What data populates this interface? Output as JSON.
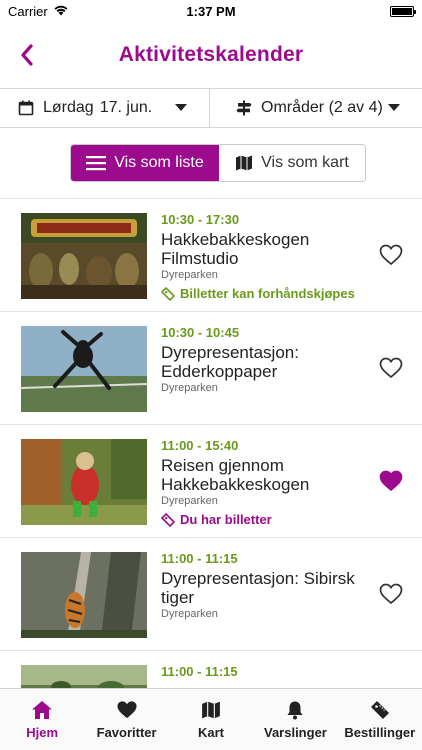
{
  "status_bar": {
    "carrier": "Carrier",
    "time": "1:37 PM",
    "battery_level": 1.0
  },
  "nav": {
    "title": "Aktivitetskalender"
  },
  "filters": {
    "day": "Lørdag",
    "date": "17. jun.",
    "areas": "Områder (2 av 4)"
  },
  "view_toggle": {
    "list_label": "Vis som liste",
    "map_label": "Vis som kart",
    "selected": "list"
  },
  "colors": {
    "accent": "#9c0b8e",
    "time_green": "#6a9a1c"
  },
  "events": [
    {
      "time": "10:30 - 17:30",
      "title": "Hakkebakkeskogen Filmstudio",
      "place": "Dyreparken",
      "tag": "Billetter kan forhåndskjøpes",
      "tag_icon": "ticket-icon",
      "favorite": false
    },
    {
      "time": "10:30 - 10:45",
      "title": "Dyrepresentasjon: Edderkoppaper",
      "place": "Dyreparken",
      "tag": "",
      "tag_icon": "",
      "favorite": false
    },
    {
      "time": "11:00 - 15:40",
      "title": "Reisen gjennom Hakkebakkeskogen",
      "place": "Dyreparken",
      "tag": "Du har billetter",
      "tag_icon": "ticket-icon",
      "favorite": true
    },
    {
      "time": "11:00 - 11:15",
      "title": "Dyrepresentasjon: Sibirsk tiger",
      "place": "Dyreparken",
      "tag": "",
      "tag_icon": "",
      "favorite": false
    },
    {
      "time": "11:00 - 11:15",
      "title": "",
      "place": "",
      "tag": "",
      "tag_icon": "",
      "favorite": false
    }
  ],
  "tabs": [
    {
      "label": "Hjem",
      "icon": "home-icon",
      "active": true
    },
    {
      "label": "Favoritter",
      "icon": "heart-icon",
      "active": false
    },
    {
      "label": "Kart",
      "icon": "map-icon",
      "active": false
    },
    {
      "label": "Varslinger",
      "icon": "bell-icon",
      "active": false
    },
    {
      "label": "Bestillinger",
      "icon": "ticket-icon",
      "active": false
    }
  ]
}
